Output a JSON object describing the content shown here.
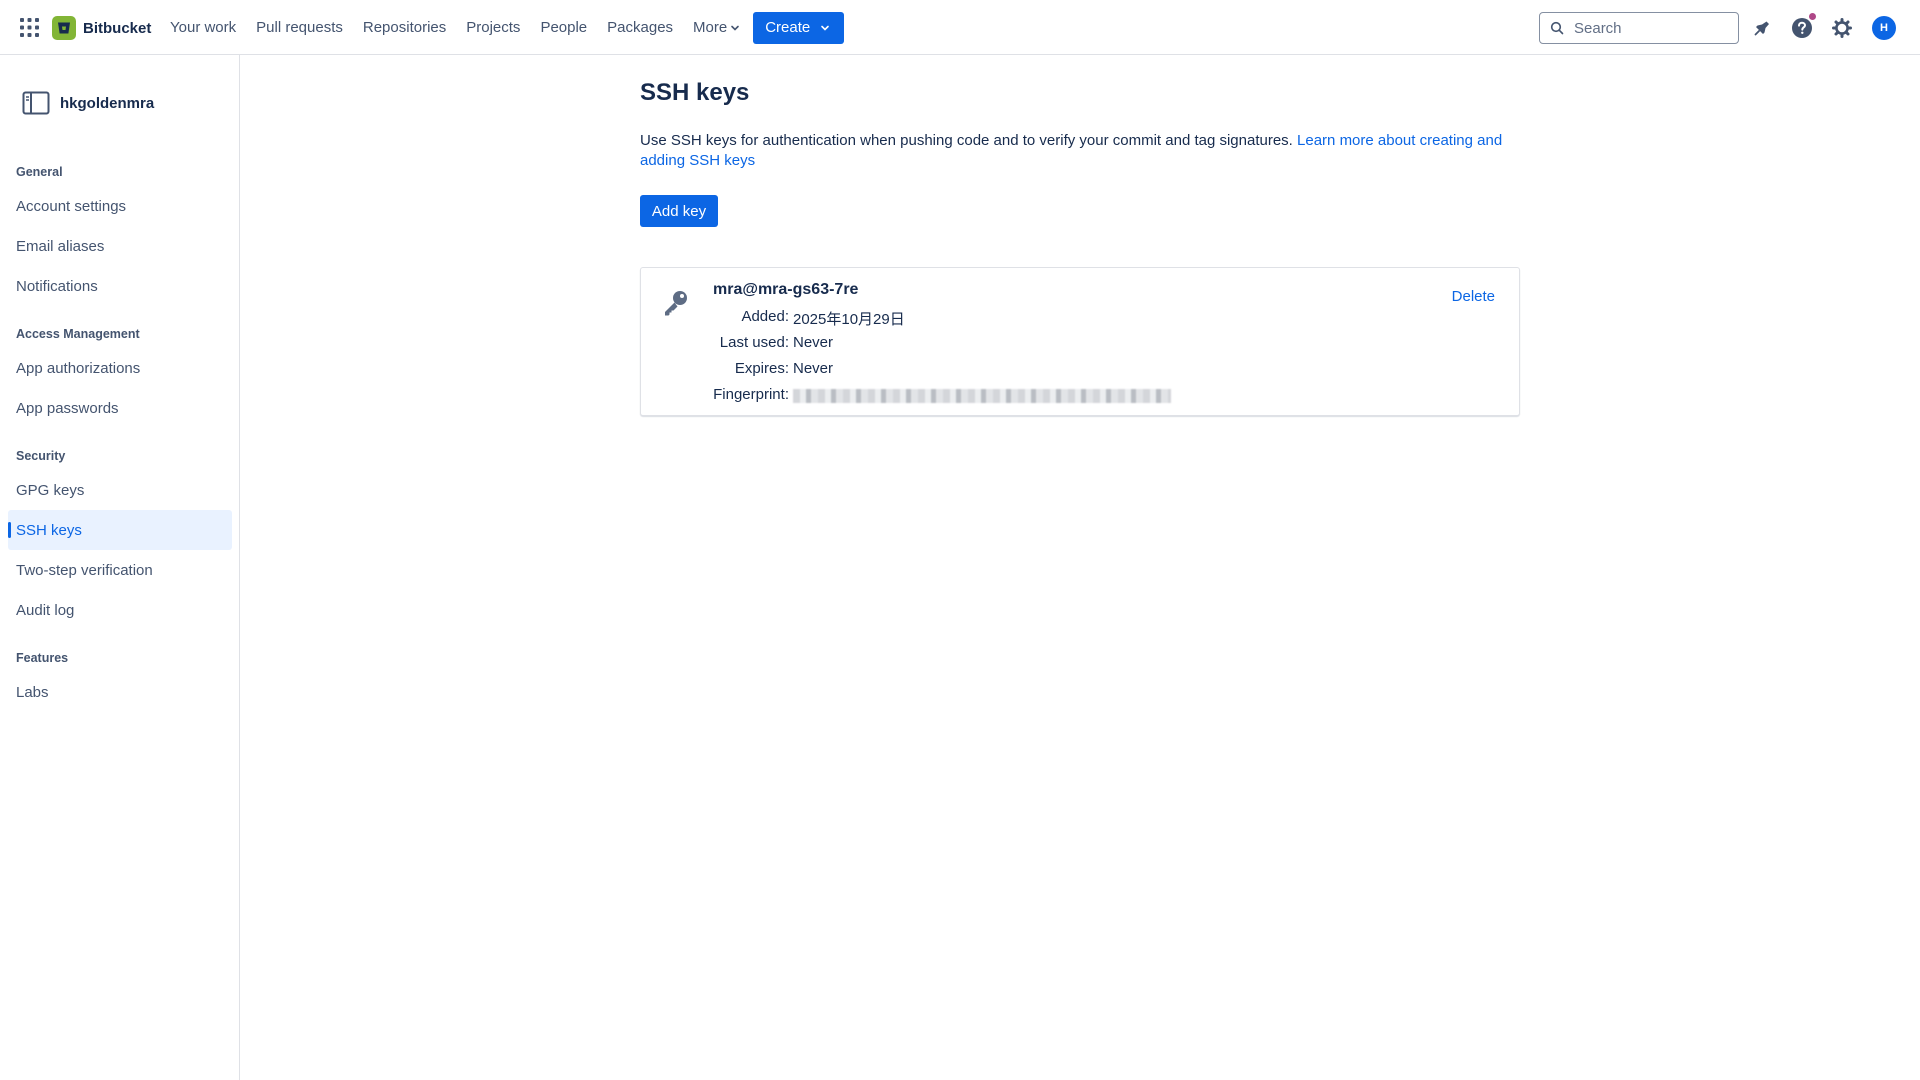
{
  "topnav": {
    "brand": "Bitbucket",
    "items": [
      "Your work",
      "Pull requests",
      "Repositories",
      "Projects",
      "People",
      "Packages"
    ],
    "more_label": "More",
    "create_label": "Create",
    "search_placeholder": "Search",
    "avatar_initial": "H"
  },
  "sidebar": {
    "workspace_name": "hkgoldenmra",
    "sections": [
      {
        "heading": "General",
        "items": [
          "Account settings",
          "Email aliases",
          "Notifications"
        ]
      },
      {
        "heading": "Access Management",
        "items": [
          "App authorizations",
          "App passwords"
        ]
      },
      {
        "heading": "Security",
        "items": [
          "GPG keys",
          "SSH keys",
          "Two-step verification",
          "Audit log"
        ]
      },
      {
        "heading": "Features",
        "items": [
          "Labs"
        ]
      }
    ],
    "active_item": "SSH keys"
  },
  "main": {
    "title": "SSH keys",
    "description": "Use SSH keys for authentication when pushing code and to verify your commit and tag signatures.",
    "learn_more_link": "Learn more about creating and adding SSH keys",
    "add_key_label": "Add key",
    "key": {
      "name": "mra@mra-gs63-7re",
      "added_label": "Added:",
      "added_value": "2025年10月29日",
      "last_used_label": "Last used:",
      "last_used_value": "Never",
      "expires_label": "Expires:",
      "expires_value": "Never",
      "fingerprint_label": "Fingerprint:",
      "delete_label": "Delete"
    }
  },
  "colors": {
    "brand_blue": "#0c66e4",
    "bitbucket_green": "#82b536",
    "active_bg": "#e9f2ff",
    "text": "#172b4d",
    "subtle_text": "#44546f",
    "help_badge": "#ae4787"
  },
  "icons": [
    "app-switcher-icon",
    "bitbucket-logo-icon",
    "chevron-down-icon",
    "search-icon",
    "notifications-icon",
    "help-icon",
    "settings-icon",
    "workspace-icon",
    "key-icon"
  ]
}
